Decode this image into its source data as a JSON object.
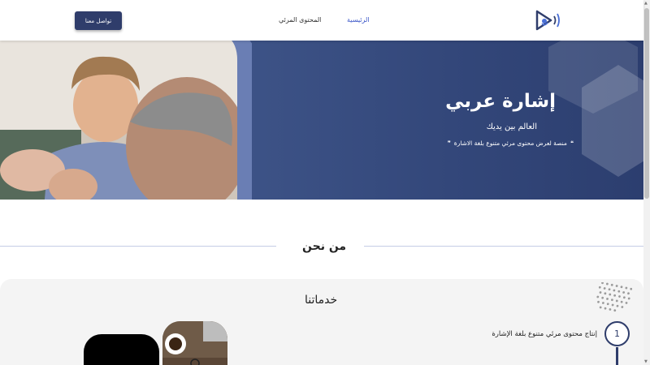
{
  "header": {
    "contact_label": "تواصل معنا",
    "nav": {
      "visual_content": "المحتوى المرئي",
      "home": "الرئيسية"
    },
    "logo_icon": "play-sign-logo-icon"
  },
  "hero": {
    "title": "إشارة عربي",
    "subtitle": "العالم بين يديك",
    "description": "منصة لعرض محتوى مرئي متنوع بلغة الاشارة"
  },
  "about": {
    "title": "من نحن"
  },
  "services": {
    "title": "خدماتنا",
    "steps": [
      {
        "number": "1",
        "text": "إنتاج محتوى مرئي متنوع بلغة الإشارة"
      }
    ]
  },
  "colors": {
    "primary": "#2f3d6b",
    "hero_bg": "#3e5488",
    "active_link": "#3a56c8"
  }
}
